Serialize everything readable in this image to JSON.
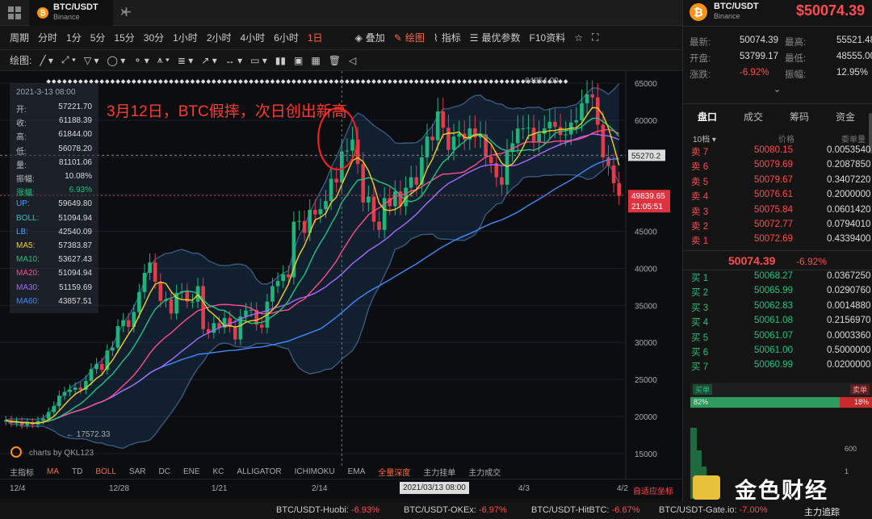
{
  "tab": {
    "title": "BTC/USDT",
    "exchange": "Binance"
  },
  "toolbar": {
    "items": [
      "周期",
      "分时",
      "1分",
      "5分",
      "15分",
      "30分",
      "1小时",
      "2小时",
      "4小时",
      "6小时",
      "1日"
    ],
    "overlay": "叠加",
    "draw": "绘图",
    "indicator": "指标",
    "best_params": "最优参数",
    "f10": "F10资料"
  },
  "drawbar": {
    "label": "绘图:"
  },
  "annotation": "3月12日，BTC假摔，次日创出新高",
  "infobox": {
    "date": "2021-3-13 08:00",
    "rows": [
      {
        "k": "开:",
        "v": "57221.70"
      },
      {
        "k": "收:",
        "v": "61188.39"
      },
      {
        "k": "高:",
        "v": "61844.00"
      },
      {
        "k": "低:",
        "v": "56078.20"
      },
      {
        "k": "量:",
        "v": "81101.06"
      },
      {
        "k": "振幅:",
        "v": "10.08%"
      },
      {
        "k": "涨幅:",
        "v": "6.93%"
      },
      {
        "k": "UP:",
        "v": "59649.80"
      },
      {
        "k": "BOLL:",
        "v": "51094.94"
      },
      {
        "k": "LB:",
        "v": "42540.09"
      },
      {
        "k": "MA5:",
        "v": "57383.87"
      },
      {
        "k": "MA10:",
        "v": "53627.43"
      },
      {
        "k": "MA20:",
        "v": "51094.94"
      },
      {
        "k": "MA30:",
        "v": "51159.69"
      },
      {
        "k": "MA60:",
        "v": "43857.51"
      }
    ]
  },
  "axis": {
    "y_ticks": [
      "65000",
      "60000",
      "55000",
      "50000",
      "45000",
      "40000",
      "35000",
      "30000",
      "25000",
      "20000",
      "15000"
    ],
    "x_ticks": [
      "12/4",
      "12/28",
      "1/21",
      "2/14",
      "3/13",
      "4/3",
      "4/2"
    ],
    "crosshair_date": "2021/03/13 08:00",
    "price_tag": "55270.2",
    "last_price": "49839.65",
    "countdown": "21:05:51",
    "low_label": "17572.33",
    "high_label": "64854.00",
    "watermark": "charts by QKL123",
    "auto_coord": "自适应坐标"
  },
  "indbar": [
    "主指标",
    "MA",
    "TD",
    "BOLL",
    "SAR",
    "DC",
    "ENE",
    "KC",
    "ALLIGATOR",
    "ICHIMOKU",
    "EMA",
    "全量深度",
    "主力挂单",
    "主力成交"
  ],
  "right": {
    "symbol": "BTC/USDT",
    "exchange": "Binance",
    "price": "$50074.39",
    "stats": [
      [
        "最新:",
        "50074.39",
        "最高:",
        "55521.48"
      ],
      [
        "开盘:",
        "53799.17",
        "最低:",
        "48555.00"
      ],
      [
        "涨跌:",
        "-6.92%",
        "振幅:",
        "12.95%"
      ]
    ],
    "tabs": [
      "盘口",
      "成交",
      "筹码",
      "资金"
    ],
    "levels": "10档",
    "col_price": "价格",
    "col_amount": "委单量",
    "asks": [
      [
        "卖 7",
        "50080.15",
        "0.0053540"
      ],
      [
        "卖 6",
        "50079.69",
        "0.2087850"
      ],
      [
        "卖 5",
        "50079.67",
        "0.3407220"
      ],
      [
        "卖 4",
        "50076.61",
        "0.2000000"
      ],
      [
        "卖 3",
        "50075.84",
        "0.0601420"
      ],
      [
        "卖 2",
        "50072.77",
        "0.0794010"
      ],
      [
        "卖 1",
        "50072.69",
        "0.4339400"
      ]
    ],
    "mid_price": "50074.39",
    "mid_change": "-6.92%",
    "bids": [
      [
        "买 1",
        "50068.27",
        "0.0367250"
      ],
      [
        "买 2",
        "50065.99",
        "0.0290760"
      ],
      [
        "买 3",
        "50062.83",
        "0.0014880"
      ],
      [
        "买 4",
        "50061.08",
        "0.2156970"
      ],
      [
        "买 5",
        "50061.07",
        "0.0003360"
      ],
      [
        "买 6",
        "50061.00",
        "0.5000000"
      ],
      [
        "买 7",
        "50060.99",
        "0.0200000"
      ]
    ],
    "buy_label": "买单",
    "sell_label": "卖单",
    "buy_pct": "82%",
    "sell_pct": "18%",
    "buy_ratio": 0.82,
    "depth_tick": "600",
    "depth_tick2": "1",
    "logo_text": "金色财经"
  },
  "ticker": [
    {
      "pair": "BTC/USDT-Huobi:",
      "chg": "-6.93%"
    },
    {
      "pair": "BTC/USDT-OKEx:",
      "chg": "-6.97%"
    },
    {
      "pair": "BTC/USDT-HitBTC:",
      "chg": "-6.67%"
    },
    {
      "pair": "BTC/USDT-Gate.io:",
      "chg": "-7.00%"
    }
  ],
  "ticker_right": "主力追踪",
  "chart_data": {
    "type": "candlestick",
    "ylim": [
      14000,
      66000
    ],
    "grid": true,
    "close_series": [
      19500,
      19100,
      19300,
      18800,
      19200,
      18900,
      19400,
      19700,
      20600,
      21400,
      22800,
      23300,
      23600,
      23900,
      23600,
      24800,
      26400,
      27100,
      26300,
      28900,
      29300,
      32200,
      33000,
      32100,
      34100,
      36800,
      39400,
      40800,
      38200,
      35600,
      35800,
      33900,
      36700,
      36900,
      35500,
      35500,
      37600,
      31800,
      31300,
      32600,
      32000,
      33300,
      32100,
      30400,
      33500,
      34300,
      34400,
      32400,
      32000,
      35500,
      37600,
      38300,
      39200,
      38800,
      46300,
      46400,
      44800,
      47900,
      47300,
      48000,
      49100,
      52100,
      51600,
      55800,
      55900,
      57400,
      54100,
      48900,
      49700,
      46300,
      45200,
      49500,
      48400,
      50400,
      48400,
      50900,
      52300,
      51300,
      55000,
      57800,
      57300,
      61200,
      59000,
      56000,
      57800,
      58200,
      57400,
      58900,
      57700,
      58100,
      55100,
      54200,
      52300,
      51300,
      55800,
      56900,
      58900,
      58900,
      59000,
      57100,
      58200,
      58900,
      59800,
      59100,
      58000,
      58100,
      59700,
      60000,
      62300,
      63500,
      63100,
      59400,
      55000,
      53900,
      51500,
      49800
    ]
  }
}
